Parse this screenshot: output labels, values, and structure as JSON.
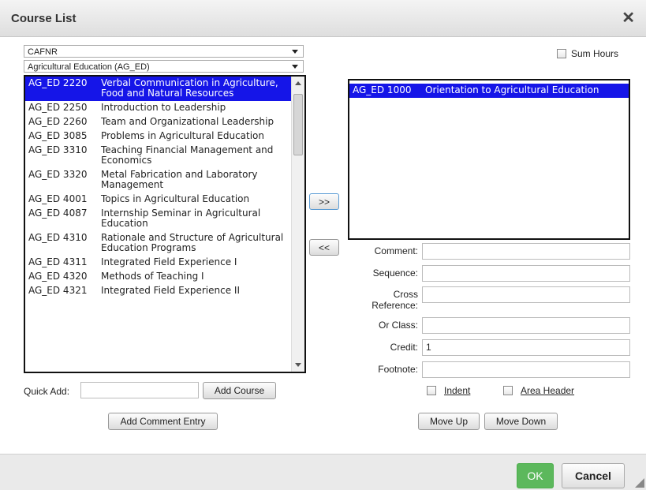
{
  "dialog": {
    "title": "Course List",
    "close_glyph": "✕"
  },
  "filters": {
    "college": "CAFNR",
    "department": "Agricultural Education (AG_ED)"
  },
  "sum_hours_label": "Sum Hours",
  "available_courses": [
    {
      "code": "AG_ED 2220",
      "name": "Verbal Communication in Agriculture, Food and Natural Resources",
      "selected": true
    },
    {
      "code": "AG_ED 2250",
      "name": "Introduction to Leadership"
    },
    {
      "code": "AG_ED 2260",
      "name": "Team and Organizational Leadership"
    },
    {
      "code": "AG_ED 3085",
      "name": "Problems in Agricultural Education"
    },
    {
      "code": "AG_ED 3310",
      "name": "Teaching Financial Management and Economics"
    },
    {
      "code": "AG_ED 3320",
      "name": "Metal Fabrication and Laboratory Management"
    },
    {
      "code": "AG_ED 4001",
      "name": "Topics in Agricultural Education"
    },
    {
      "code": "AG_ED 4087",
      "name": "Internship Seminar in Agricultural Education"
    },
    {
      "code": "AG_ED 4310",
      "name": "Rationale and Structure of Agricultural Education Programs"
    },
    {
      "code": "AG_ED 4311",
      "name": "Integrated Field Experience I"
    },
    {
      "code": "AG_ED 4320",
      "name": "Methods of Teaching I"
    },
    {
      "code": "AG_ED 4321",
      "name": "Integrated Field Experience II"
    }
  ],
  "selected_courses": [
    {
      "code": "AG_ED 1000",
      "name": "Orientation to Agricultural Education"
    }
  ],
  "buttons": {
    "add": ">>",
    "remove": "<<",
    "add_course": "Add Course",
    "add_comment_entry": "Add Comment Entry",
    "move_up": "Move Up",
    "move_down": "Move Down",
    "ok": "OK",
    "cancel": "Cancel"
  },
  "quick_add": {
    "label": "Quick Add:",
    "value": ""
  },
  "form": {
    "comment": {
      "label": "Comment:",
      "value": ""
    },
    "sequence": {
      "label": "Sequence:",
      "value": ""
    },
    "cross_reference": {
      "label_1": "Cross",
      "label_2": "Reference:",
      "value": ""
    },
    "or_class": {
      "label": "Or Class:",
      "value": ""
    },
    "credit": {
      "label": "Credit:",
      "value": "1"
    },
    "footnote": {
      "label": "Footnote:",
      "value": ""
    }
  },
  "checkboxes": {
    "indent": "Indent",
    "area_header": "Area Header"
  },
  "colors": {
    "selection": "#1515e8",
    "ok_green": "#5cb85c"
  }
}
